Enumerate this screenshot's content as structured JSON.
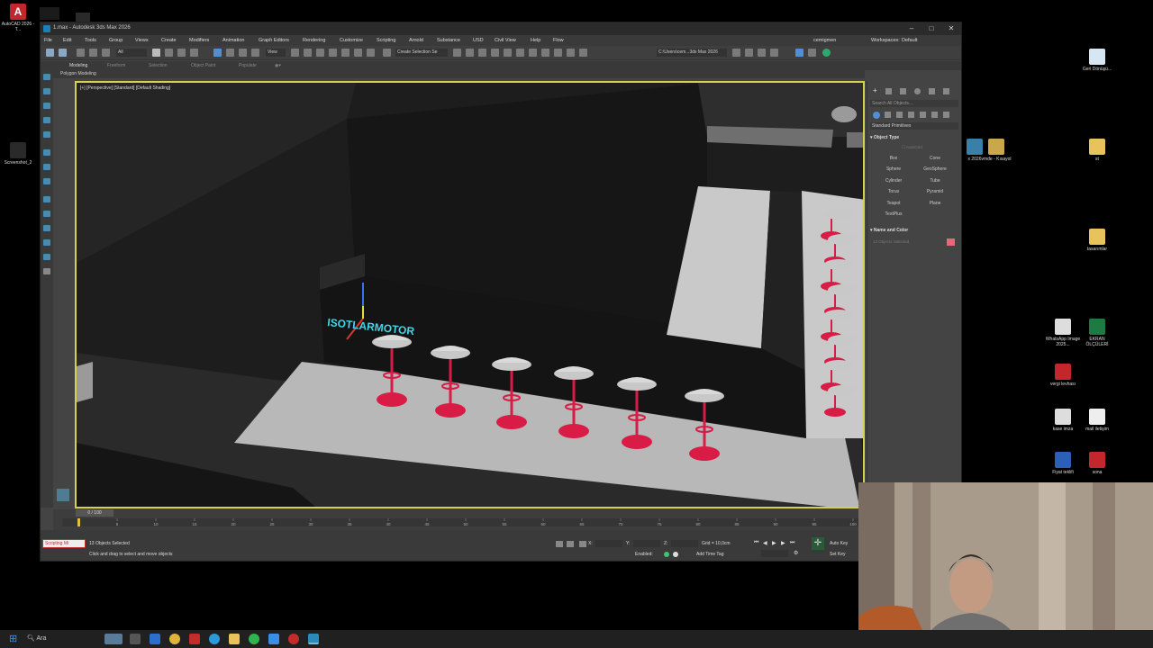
{
  "window": {
    "title": "1.max - Autodesk 3ds Max 2026",
    "user": "cemigmen",
    "workspace_label": "Workspaces:",
    "workspace_value": "Default"
  },
  "menus": [
    "File",
    "Edit",
    "Tools",
    "Group",
    "Views",
    "Create",
    "Modifiers",
    "Animation",
    "Graph Editors",
    "Rendering",
    "Customize",
    "Scripting",
    "Arnold",
    "Substance",
    "USD",
    "Civil View",
    "Help",
    "Flow"
  ],
  "toolbar": {
    "selection_set": "Create Selection Se",
    "path": "C:\\Users\\cem...3ds Max 2026",
    "filter": "All",
    "view": "View"
  },
  "ribbon": {
    "tabs": [
      "Modeling",
      "Freeform",
      "Selection",
      "Object Paint",
      "Populate"
    ],
    "subtab": "Polygon Modeling"
  },
  "viewport": {
    "label": "[+] [Perspective] [Standard] [Default Shading]",
    "sign_text": "ISOTLARMOTOR"
  },
  "command_panel": {
    "search_placeholder": "Search All Objects...",
    "category": "Standard Primitives",
    "object_type_title": "Object Type",
    "autogrid": "AutoGrid",
    "buttons": [
      "Box",
      "Cone",
      "Sphere",
      "GeoSphere",
      "Cylinder",
      "Tube",
      "Torus",
      "Pyramid",
      "Teapot",
      "Plane",
      "TextPlus"
    ],
    "name_color_title": "Name and Color",
    "name_field": "13 Objects Selected",
    "swatch_color": "#e46a78"
  },
  "timeline": {
    "frame": "0 / 100",
    "ticks": [
      "0",
      "5",
      "10",
      "15",
      "20",
      "25",
      "30",
      "35",
      "40",
      "45",
      "50",
      "55",
      "60",
      "65",
      "70",
      "75",
      "80",
      "85",
      "90",
      "95",
      "100"
    ]
  },
  "status": {
    "script_label": "Scripting Mi",
    "selected": "13 Objects Selected",
    "hint": "Click and drag to select and move objects",
    "x_label": "X:",
    "y_label": "Y:",
    "z_label": "Z:",
    "grid": "Grid = 10,0cm",
    "enabled": "Enabled:",
    "add_time_tag": "Add Time Tag",
    "auto_key": "Auto Key",
    "set_key": "Set Key"
  },
  "desktop": {
    "left_icons": [
      {
        "label": "AutoCAD 2026 - T...",
        "color": "#c4262e"
      },
      {
        "label": "Screenshot_2",
        "color": "#333333"
      }
    ],
    "right_icons": [
      {
        "label": "Geri Dönüşü...",
        "color": "#d6e6f2"
      },
      {
        "label": "st",
        "color": "#e8c25a"
      },
      {
        "label": "tasarımlar",
        "color": "#e8c25a"
      },
      {
        "label": "WhatsApp Image 2025...",
        "color": "#dddddd"
      },
      {
        "label": "EKRAN ÖLÇÜLERİ",
        "color": "#1e7a43"
      },
      {
        "label": "vergi levhası",
        "color": "#c4262e"
      },
      {
        "label": "kase imza",
        "color": "#dddddd"
      },
      {
        "label": "mail iletişim",
        "color": "#eeeeee"
      },
      {
        "label": "Fiyat teklifi",
        "color": "#2b5fb8"
      },
      {
        "label": "sona",
        "color": "#c4262e"
      }
    ],
    "mid_icons": [
      {
        "label": "x 2026",
        "color": "#3a7fa8"
      },
      {
        "label": "vmde - Kısayol",
        "color": "#c9a74a"
      }
    ]
  },
  "taskbar": {
    "search_label": "Ara"
  },
  "colors": {
    "viewport_border": "#d7d04a",
    "stool_base": "#d81c46",
    "stool_seat": "#c8c8c8",
    "sign": "#3fd7e6"
  }
}
